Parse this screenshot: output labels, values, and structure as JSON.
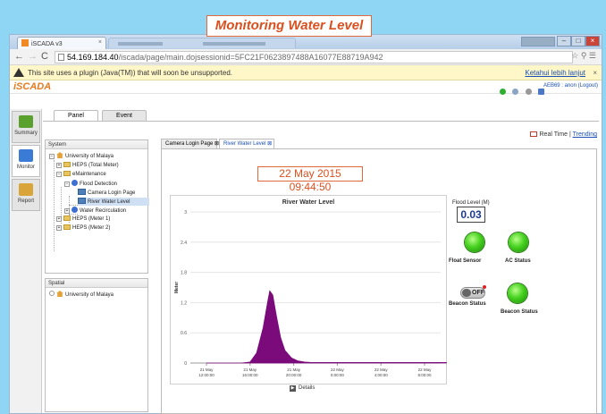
{
  "caption": "Monitoring Water Level",
  "browser": {
    "tab_title": "iSCADA v3",
    "url_host": "54.169.184.40",
    "url_path": "/iscada/page/main.dojsessionid=5FC21F0623897488A16077E88719A942",
    "infobar_text": "This site uses a plugin (Java(TM)) that will soon be unsupported.",
    "infobar_link": "Ketahui lebih lanjut"
  },
  "app": {
    "logo": "iSCADA",
    "user_text": "AEB69 : anon (Logout)",
    "sidebar": [
      {
        "label": "Summary",
        "color": "#5aa02c"
      },
      {
        "label": "Monitor",
        "color": "#3a7bd5"
      },
      {
        "label": "Report",
        "color": "#d9a53a"
      }
    ],
    "panel_tabs": [
      "Panel",
      "Event"
    ],
    "realtime_label": "Real Time",
    "separator": "|",
    "trending_label": "Trending",
    "system_panel_title": "System",
    "spatial_panel_title": "Spatial",
    "tree": {
      "root": "University of Malaya",
      "heps_total": "HEPS (Total Meter)",
      "eMaintenance": "eMaintenance",
      "flood_detection": "Flood Detection",
      "camera_login": "Camera Login Page",
      "river_water": "River Water Level",
      "water_recirculation": "Water Recirculation",
      "heps_meter1": "HEPS (Meter 1)",
      "heps_meter2": "HEPS (Meter 2)"
    },
    "spatial_root": "University of Malaya",
    "content_tabs": [
      "Camera Login Page",
      "River Water Level"
    ],
    "datetime": "22 May 2015 09:44:50",
    "details_label": "Details",
    "flood_level_label": "Flood Level (M)",
    "flood_level_value": "0.03",
    "indicators": {
      "float_sensor": "Float Sensor",
      "ac_status": "AC Status",
      "beacon_status_1": "Beacon Status",
      "beacon_status_2": "Beacon Status",
      "toggle_text": "OFF"
    }
  },
  "chart_data": {
    "type": "area",
    "title": "River Water Level",
    "ylabel": "Meter",
    "ylim": [
      0,
      3
    ],
    "yticks": [
      "0",
      "0.6",
      "1.2",
      "1.8",
      "2.4",
      "3"
    ],
    "xticks": [
      "21 May\n12:00:00",
      "21 May\n16:00:00",
      "21 May\n20:00:00",
      "22 May\n0:00:00",
      "22 May\n4:00:00",
      "22 May\n8:00:00"
    ],
    "series": [
      {
        "color": "#7b0a7b",
        "x": [
          0,
          0.8,
          1.0,
          1.15,
          1.3,
          1.4,
          1.45,
          1.52,
          1.6,
          1.7,
          1.8,
          1.95,
          2.1,
          2.25,
          2.4,
          5.5
        ],
        "y": [
          0,
          0,
          0.02,
          0.2,
          0.7,
          1.2,
          1.43,
          1.35,
          0.95,
          0.5,
          0.25,
          0.1,
          0.04,
          0.02,
          0.01,
          0.01
        ]
      }
    ]
  }
}
